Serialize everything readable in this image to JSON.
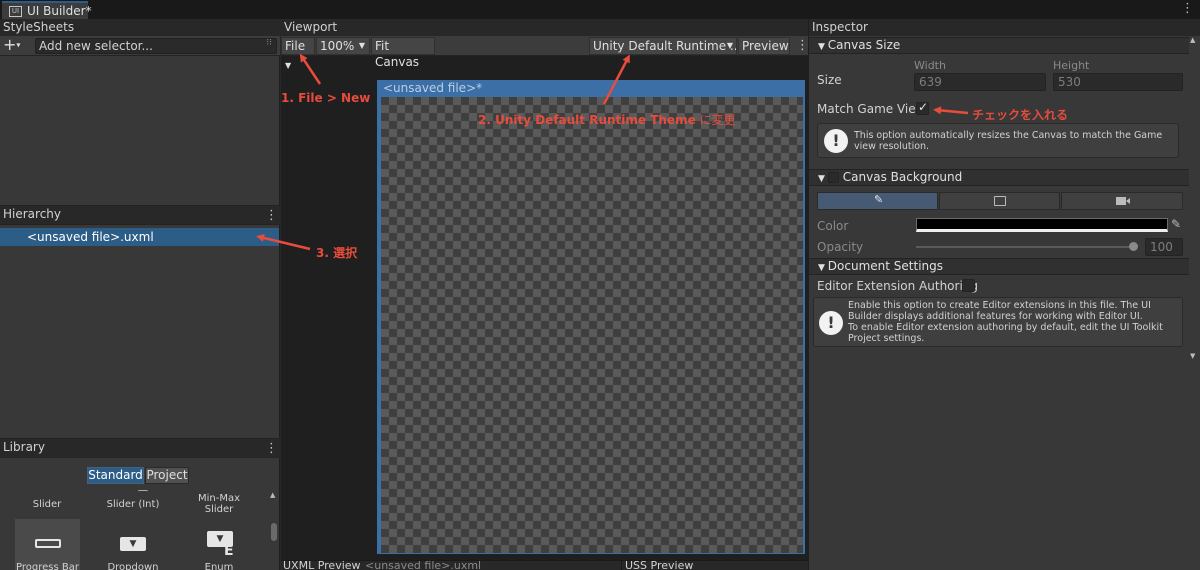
{
  "window": {
    "title": "UI Builder*",
    "icon_text": "UI"
  },
  "stylesheets": {
    "header": "StyleSheets",
    "selector_placeholder": "Add new selector..."
  },
  "hierarchy": {
    "header": "Hierarchy",
    "item": "<unsaved file>.uxml"
  },
  "library": {
    "header": "Library",
    "tabs": [
      "Standard",
      "Project"
    ],
    "row1": [
      "Slider",
      "Slider (Int)",
      "Min-Max Slider"
    ],
    "row2": [
      "Progress Bar",
      "Dropdown",
      "Enum"
    ]
  },
  "viewport": {
    "header": "Viewport",
    "file_menu": "File",
    "zoom": "100%",
    "fit_canvas": "Fit Canvas",
    "theme": "Unity Default Runtime ...",
    "preview": "Preview",
    "canvas_title": "<unsaved file>*"
  },
  "bottom": {
    "uxml_preview": "UXML Preview",
    "uxml_file": "<unsaved file>.uxml",
    "uss_preview": "USS Preview"
  },
  "inspector": {
    "header": "Inspector",
    "canvas_size": {
      "title": "Canvas Size",
      "size_label": "Size",
      "width_label": "Width",
      "width_value": "639",
      "height_label": "Height",
      "height_value": "530",
      "match_label": "Match Game View",
      "match_checked": true,
      "help": "This option automatically resizes the Canvas to match the Game view resolution."
    },
    "canvas_background": {
      "title": "Canvas Background",
      "color_label": "Color",
      "color_value": "#000000",
      "opacity_label": "Opacity",
      "opacity_value": "100"
    },
    "document_settings": {
      "title": "Document Settings",
      "editor_ext_label": "Editor Extension Authoring",
      "help": "Enable this option to create Editor extensions in this file. The UI Builder displays additional features for working with Editor UI.\nTo enable Editor extension authoring by default, edit the UI Toolkit Project settings."
    }
  },
  "annotations": {
    "a1": "1. File > New",
    "a2_prefix": "2. Unity Default Runtime Theme",
    "a2_suffix": " に変更",
    "a3": "3. 選択",
    "a4": "チェックを入れる"
  },
  "colors": {
    "accent": "#2c5d87",
    "annotation": "#e74c3c",
    "canvas_frame": "#3c6fa6"
  }
}
